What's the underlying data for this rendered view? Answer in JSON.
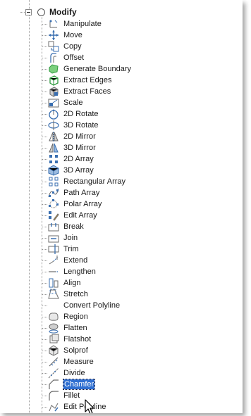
{
  "tree": {
    "root_label": "Modify",
    "selected_index": 32,
    "items": [
      {
        "label": "Manipulate",
        "icon": "manipulate-icon"
      },
      {
        "label": "Move",
        "icon": "move-icon"
      },
      {
        "label": "Copy",
        "icon": "copy-icon"
      },
      {
        "label": "Offset",
        "icon": "offset-icon"
      },
      {
        "label": "Generate Boundary",
        "icon": "boundary-icon"
      },
      {
        "label": "Extract Edges",
        "icon": "extract-edges-icon"
      },
      {
        "label": "Extract Faces",
        "icon": "extract-faces-icon"
      },
      {
        "label": "Scale",
        "icon": "scale-icon"
      },
      {
        "label": "2D Rotate",
        "icon": "rotate-2d-icon"
      },
      {
        "label": "3D Rotate",
        "icon": "rotate-3d-icon"
      },
      {
        "label": "2D Mirror",
        "icon": "mirror-2d-icon"
      },
      {
        "label": "3D Mirror",
        "icon": "mirror-3d-icon"
      },
      {
        "label": "2D Array",
        "icon": "array-2d-icon"
      },
      {
        "label": "3D Array",
        "icon": "array-3d-icon"
      },
      {
        "label": "Rectangular Array",
        "icon": "rect-array-icon"
      },
      {
        "label": "Path Array",
        "icon": "path-array-icon"
      },
      {
        "label": "Polar Array",
        "icon": "polar-array-icon"
      },
      {
        "label": "Edit Array",
        "icon": "edit-array-icon"
      },
      {
        "label": "Break",
        "icon": "break-icon"
      },
      {
        "label": "Join",
        "icon": "join-icon"
      },
      {
        "label": "Trim",
        "icon": "trim-icon"
      },
      {
        "label": "Extend",
        "icon": "extend-icon"
      },
      {
        "label": "Lengthen",
        "icon": "lengthen-icon"
      },
      {
        "label": "Align",
        "icon": "align-icon"
      },
      {
        "label": "Stretch",
        "icon": "stretch-icon"
      },
      {
        "label": "Convert Polyline",
        "icon": ""
      },
      {
        "label": "Region",
        "icon": "region-icon"
      },
      {
        "label": "Flatten",
        "icon": "flatten-icon"
      },
      {
        "label": "Flatshot",
        "icon": "flatshot-icon"
      },
      {
        "label": "Solprof",
        "icon": "solprof-icon"
      },
      {
        "label": "Measure",
        "icon": "measure-icon"
      },
      {
        "label": "Divide",
        "icon": "divide-icon"
      },
      {
        "label": "Chamfer",
        "icon": "chamfer-icon"
      },
      {
        "label": "Fillet",
        "icon": "fillet-icon"
      },
      {
        "label": "Edit Polyline",
        "icon": "edit-polyline-icon"
      }
    ]
  },
  "colors": {
    "selection": "#2f6fd1",
    "icon_blue": "#3a6fb0",
    "icon_gray": "#6b6b6b",
    "icon_green": "#2e9a3e"
  }
}
